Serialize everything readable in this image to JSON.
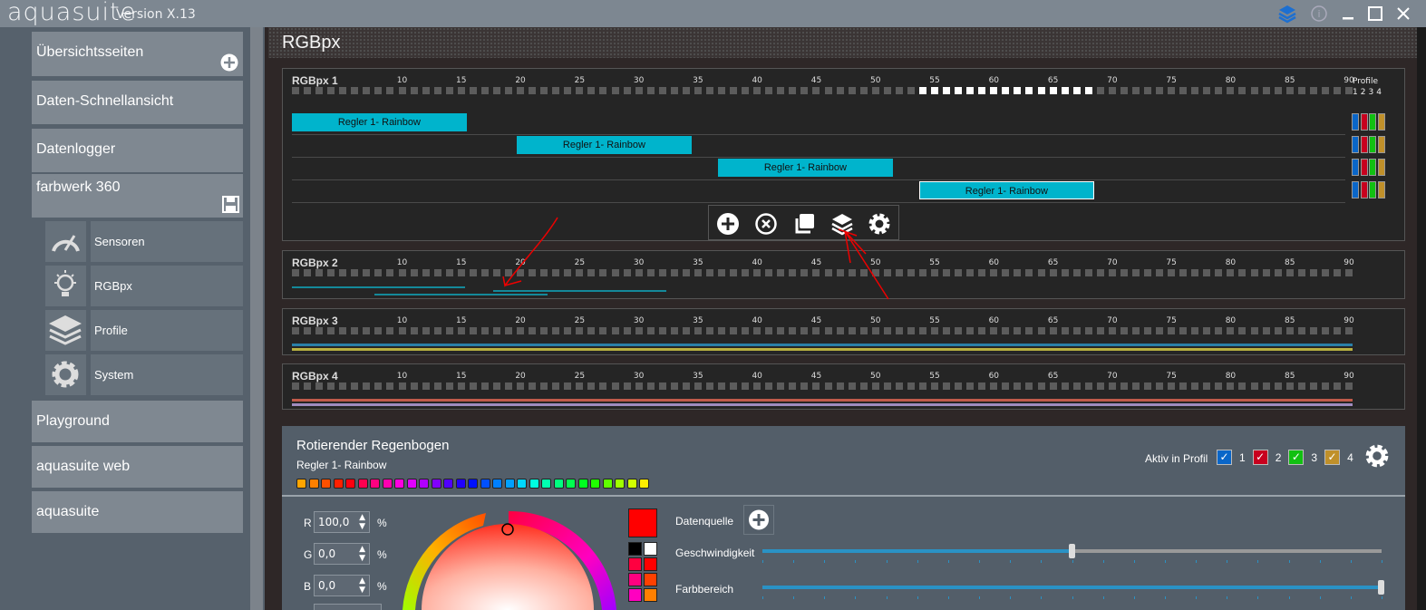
{
  "app": {
    "name": "aquasuite",
    "version": "Version X.13"
  },
  "titlebar_icons": [
    "layers-icon",
    "info-icon",
    "minimize-icon",
    "maximize-icon",
    "close-icon"
  ],
  "sidebar": {
    "top_items": [
      {
        "label": "Übersichtsseiten"
      },
      {
        "label": "Daten-Schnellansicht"
      },
      {
        "label": "Datenlogger"
      }
    ],
    "device": {
      "label": "farbwerk 360"
    },
    "sub_items": [
      {
        "label": "Sensoren",
        "icon": "gauge-icon"
      },
      {
        "label": "RGBpx",
        "icon": "lightbulb-icon"
      },
      {
        "label": "Profile",
        "icon": "layers-icon"
      },
      {
        "label": "System",
        "icon": "gear-icon"
      }
    ],
    "bottom_items": [
      {
        "label": "Playground"
      },
      {
        "label": "aquasuite web"
      },
      {
        "label": "aquasuite"
      }
    ]
  },
  "main": {
    "title": "RGBpx"
  },
  "led_count": 90,
  "ticks": [
    10,
    15,
    20,
    25,
    30,
    35,
    40,
    45,
    50,
    55,
    60,
    65,
    70,
    75,
    80,
    85,
    90
  ],
  "profile_header": {
    "label": "Profile",
    "numbers": [
      "1",
      "2",
      "3",
      "4"
    ]
  },
  "profile_colors": [
    "#0a66c8",
    "#c8001e",
    "#12c012",
    "#c0902a"
  ],
  "strips": [
    {
      "name": "RGBpx 1",
      "active_leds": [
        54,
        68
      ],
      "zones": [
        {
          "label": "Regler 1- Rainbow",
          "from": 1,
          "to": 15
        },
        {
          "label": "Regler 1- Rainbow",
          "from": 20,
          "to": 34
        },
        {
          "label": "Regler 1- Rainbow",
          "from": 37,
          "to": 51
        },
        {
          "label": "Regler 1- Rainbow",
          "from": 54,
          "to": 68,
          "selected": true
        }
      ]
    },
    {
      "name": "RGBpx 2",
      "lines": [
        {
          "from": 1,
          "to": 15,
          "color": "#14899a"
        },
        {
          "from": 8,
          "to": 22,
          "color": "#14899a"
        },
        {
          "from": 18,
          "to": 32,
          "color": "#14899a"
        }
      ]
    },
    {
      "name": "RGBpx 3",
      "lines": [
        {
          "from": 1,
          "to": 90,
          "color": "#2a7fa8"
        },
        {
          "from": 1,
          "to": 90,
          "color": "#b8b040"
        }
      ]
    },
    {
      "name": "RGBpx 4",
      "lines": [
        {
          "from": 1,
          "to": 90,
          "color": "#c05a4a"
        },
        {
          "from": 1,
          "to": 90,
          "color": "#a08cc0"
        }
      ]
    }
  ],
  "toolbar": [
    "add-icon",
    "remove-icon",
    "copy-icon",
    "layers-icon",
    "gear-icon"
  ],
  "editor": {
    "title": "Rotierender Regenbogen",
    "subtitle": "Regler 1- Rainbow",
    "gradient": [
      "#ffa500",
      "#ff8000",
      "#ff5000",
      "#ff2000",
      "#ff0010",
      "#ff0050",
      "#ff0080",
      "#ff00b0",
      "#ff00e0",
      "#e000ff",
      "#b000ff",
      "#8000ff",
      "#5000ff",
      "#2000ff",
      "#0010ff",
      "#0050ff",
      "#0080ff",
      "#00a0ff",
      "#00d8ff",
      "#00ffe0",
      "#00ffb0",
      "#00ff80",
      "#00ff50",
      "#00ff20",
      "#20ff00",
      "#60ff00",
      "#a0ff00",
      "#d0ff00",
      "#ffee00"
    ],
    "aktiv_label": "Aktiv in Profil",
    "profiles": [
      "1",
      "2",
      "3",
      "4"
    ],
    "r": {
      "label": "R",
      "value": "100,0",
      "unit": "%"
    },
    "g": {
      "label": "G",
      "value": "0,0",
      "unit": "%"
    },
    "b": {
      "label": "B",
      "value": "0,0",
      "unit": "%"
    },
    "current_color": "#ff0000",
    "palette": [
      "#000000",
      "#ffffff",
      "#ff0040",
      "#ff0000",
      "#ff0080",
      "#ff4000",
      "#ff00c0",
      "#ff8000"
    ],
    "datenquelle": "Datenquelle",
    "geschwindigkeit": {
      "label": "Geschwindigkeit",
      "value": 0.5
    },
    "farbbereich": {
      "label": "Farbbereich",
      "value": 1.0
    }
  }
}
